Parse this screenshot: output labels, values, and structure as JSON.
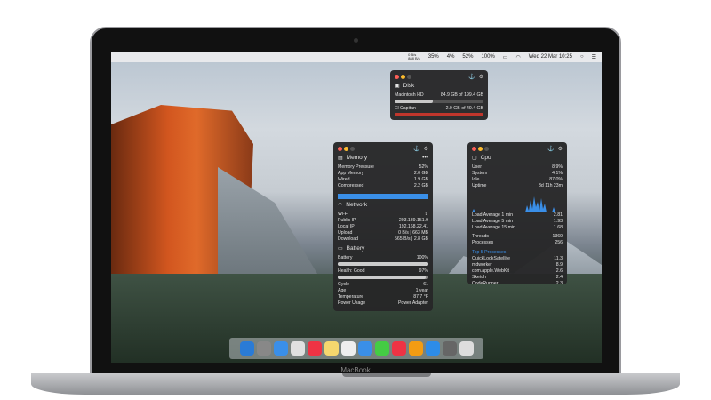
{
  "menubar": {
    "net_up": "0 B/s",
    "net_down": "888 B/s",
    "cpu": "35%",
    "gpu": "4%",
    "mem": "52%",
    "battery": "100%",
    "clock": "Wed 22 Mar 10:25"
  },
  "brand": "MacBook",
  "disk": {
    "title": "Disk",
    "items": [
      {
        "label": "Macintosh HD",
        "value": "84.9 GB of 199.4 GB",
        "fill": 0.43,
        "color": "#c8c8c8"
      },
      {
        "label": "El Capitan",
        "value": "2.0 GB of 49.4 GB",
        "fill": 1.0,
        "color": "#c0362c"
      }
    ]
  },
  "memory": {
    "title": "Memory",
    "more": "•••",
    "rows": [
      {
        "k": "Memory Pressure",
        "v": "52%"
      },
      {
        "k": "App Memory",
        "v": "2.0 GB"
      },
      {
        "k": "Wired",
        "v": "1.9 GB"
      },
      {
        "k": "Compressed",
        "v": "2.2 GB"
      }
    ],
    "bar_color": "#3a8fe8"
  },
  "network": {
    "title": "Network",
    "interface": "Wi-Fi",
    "rows": [
      {
        "k": "Public IP",
        "v": "203.189.151.9"
      },
      {
        "k": "Local IP",
        "v": "192.168.22.41"
      },
      {
        "k": "Upload",
        "v": "0 B/s  |  663 MB"
      },
      {
        "k": "Download",
        "v": "565 B/s  |  2.8 GB"
      }
    ]
  },
  "battery": {
    "title": "Battery",
    "charge_label": "Battery",
    "charge": "100%",
    "charge_fill": 1.0,
    "health_label": "Health: Good",
    "health": "97%",
    "health_fill": 0.97,
    "rows": [
      {
        "k": "Cycle",
        "v": "61"
      },
      {
        "k": "Age",
        "v": "1 year"
      },
      {
        "k": "Temperature",
        "v": "87.7 °F"
      },
      {
        "k": "Power Usage",
        "v": "Power Adapter"
      }
    ]
  },
  "cpu": {
    "title": "Cpu",
    "rows": [
      {
        "k": "User",
        "v": "8.9%"
      },
      {
        "k": "System",
        "v": "4.1%"
      },
      {
        "k": "Idle",
        "v": "87.0%"
      },
      {
        "k": "Uptime",
        "v": "3d 11h 23m"
      }
    ],
    "load": [
      {
        "k": "Load Average 1 min",
        "v": "2.81"
      },
      {
        "k": "Load Average 5 min",
        "v": "1.93"
      },
      {
        "k": "Load Average 15 min",
        "v": "1.68"
      }
    ],
    "counts": [
      {
        "k": "Threads",
        "v": "1369"
      },
      {
        "k": "Processes",
        "v": "256"
      }
    ],
    "top_title": "Top 5 Processes",
    "top": [
      {
        "k": "QuickLookSatellite",
        "v": "11.3"
      },
      {
        "k": "mdworker",
        "v": "8.9"
      },
      {
        "k": "com.apple.WebKit",
        "v": "2.6"
      },
      {
        "k": "Sketch",
        "v": "2.4"
      },
      {
        "k": "CodeRunner",
        "v": "2.3"
      }
    ]
  }
}
